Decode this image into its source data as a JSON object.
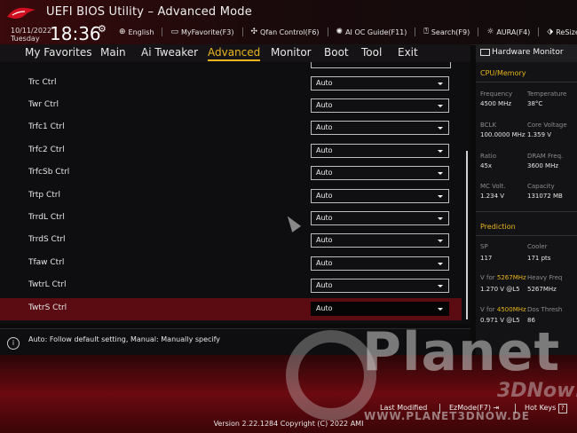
{
  "header": {
    "title": "UEFI BIOS Utility – Advanced Mode",
    "date": "10/11/2022",
    "day": "Tuesday",
    "time": "18:36",
    "tools": [
      {
        "icon": "globe-icon",
        "label": "English"
      },
      {
        "icon": "monitor-icon",
        "label": "MyFavorite(F3)"
      },
      {
        "icon": "fan-icon",
        "label": "Qfan Control(F6)"
      },
      {
        "icon": "ai-icon",
        "label": "AI OC Guide(F11)"
      },
      {
        "icon": "search-icon",
        "label": "Search(F9)"
      },
      {
        "icon": "aura-icon",
        "label": "AURA(F4)"
      },
      {
        "icon": "resize-bar-icon",
        "label": "ReSize BAR"
      }
    ]
  },
  "menu": {
    "items": [
      "My Favorites",
      "Main",
      "Ai Tweaker",
      "Advanced",
      "Monitor",
      "Boot",
      "Tool",
      "Exit"
    ],
    "active": "Advanced"
  },
  "settings": [
    {
      "label": "Trc Ctrl",
      "value": "Auto"
    },
    {
      "label": "Twr Ctrl",
      "value": "Auto"
    },
    {
      "label": "Trfc1 Ctrl",
      "value": "Auto"
    },
    {
      "label": "Trfc2 Ctrl",
      "value": "Auto"
    },
    {
      "label": "TrfcSb Ctrl",
      "value": "Auto"
    },
    {
      "label": "Trtp Ctrl",
      "value": "Auto"
    },
    {
      "label": "TrrdL Ctrl",
      "value": "Auto"
    },
    {
      "label": "TrrdS Ctrl",
      "value": "Auto"
    },
    {
      "label": "Tfaw Ctrl",
      "value": "Auto"
    },
    {
      "label": "TwtrL Ctrl",
      "value": "Auto"
    },
    {
      "label": "TwtrS Ctrl",
      "value": "Auto"
    }
  ],
  "help": "Auto: Follow default setting, Manual: Manually specify",
  "hardware_monitor": {
    "title": "Hardware Monitor",
    "cpu_memory": {
      "section": "CPU/Memory",
      "frequency_label": "Frequency",
      "frequency": "4500 MHz",
      "temperature_label": "Temperature",
      "temperature": "38°C",
      "bclk_label": "BCLK",
      "bclk": "100.0000 MHz",
      "core_voltage_label": "Core Voltage",
      "core_voltage": "1.359 V",
      "ratio_label": "Ratio",
      "ratio": "45x",
      "dram_freq_label": "DRAM Freq.",
      "dram_freq": "3600 MHz",
      "mc_volt_label": "MC Volt.",
      "mc_volt": "1.234 V",
      "capacity_label": "Capacity",
      "capacity": "131072 MB"
    },
    "prediction": {
      "section": "Prediction",
      "sp_label": "SP",
      "sp": "117",
      "cooler_label": "Cooler",
      "cooler": "171 pts",
      "v_for_1_prefix": "V for ",
      "v_for_1_freq": "5267MHz",
      "heavy_freq_label": "Heavy Freq",
      "v_for_1_value": "1.270 V @L5",
      "heavy_freq": "5267MHz",
      "v_for_2_prefix": "V for ",
      "v_for_2_freq": "4500MHz",
      "dos_thresh_label": "Dos Thresh",
      "v_for_2_value": "0.971 V @L5",
      "dos_thresh": "86"
    }
  },
  "footer": {
    "last_modified": "Last Modified",
    "ezmode": "EzMode(F7)",
    "hot_keys": "Hot Keys",
    "hot_keys_key": "?",
    "version": "Version 2.22.1284 Copyright (C) 2022 AMI"
  },
  "watermark": {
    "word": "Planet",
    "tagline": "3DNow!",
    "url": "WWW.PLANET3DNOW.DE"
  },
  "colors": {
    "accent": "#e8b51e",
    "highlight_row": "#5a0c12"
  }
}
